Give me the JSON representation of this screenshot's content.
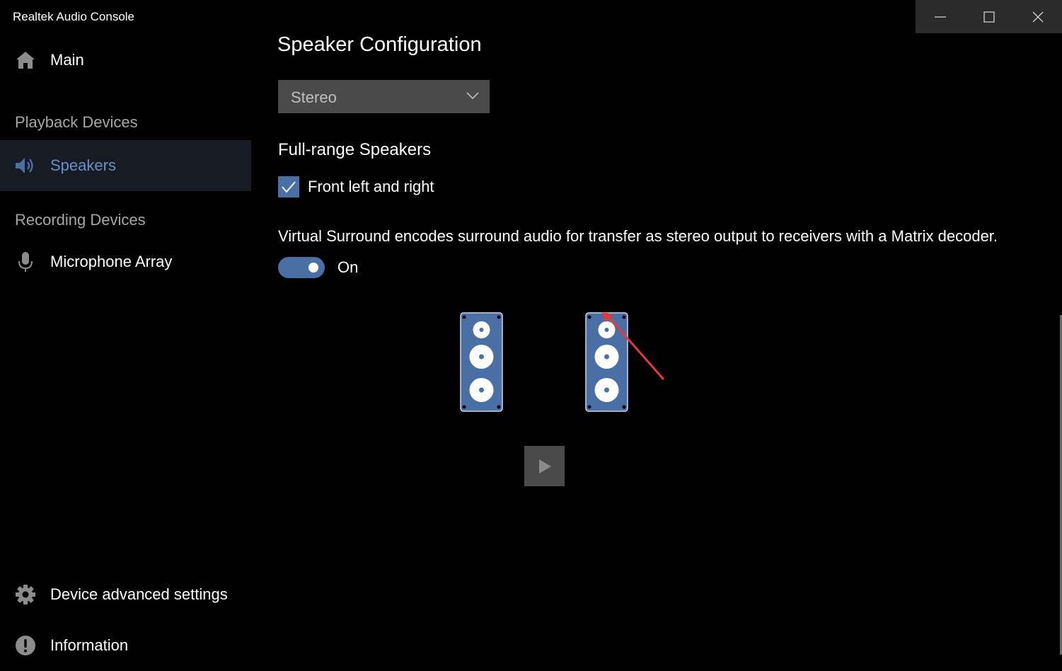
{
  "window": {
    "title": "Realtek Audio Console",
    "controls": [
      "minimize-icon",
      "maximize-icon",
      "close-icon"
    ]
  },
  "sidebar": {
    "main_label": "Main",
    "playback_header": "Playback Devices",
    "speakers_label": "Speakers",
    "recording_header": "Recording Devices",
    "microphone_label": "Microphone Array",
    "advanced_label": "Device advanced settings",
    "information_label": "Information",
    "icons": {
      "main": "home-icon",
      "speakers": "speaker-icon",
      "microphone": "microphone-icon",
      "advanced": "gear-icon",
      "information": "info-icon"
    }
  },
  "content": {
    "title": "Speaker Configuration",
    "configuration_value": "Stereo",
    "full_range_header": "Full-range Speakers",
    "front_checkbox_label": "Front left and right",
    "front_checkbox_checked": true,
    "virtual_surround_description": "Virtual Surround encodes surround audio for transfer as stereo output to receivers with a Matrix decoder.",
    "virtual_surround_state": "On",
    "virtual_surround_enabled": true
  },
  "colors": {
    "background": "#000000",
    "accent": "#4a6fa5",
    "selected_text": "#6a8fc7",
    "selected_background": "#171c24",
    "annotation_arrow": "#e8383d"
  }
}
